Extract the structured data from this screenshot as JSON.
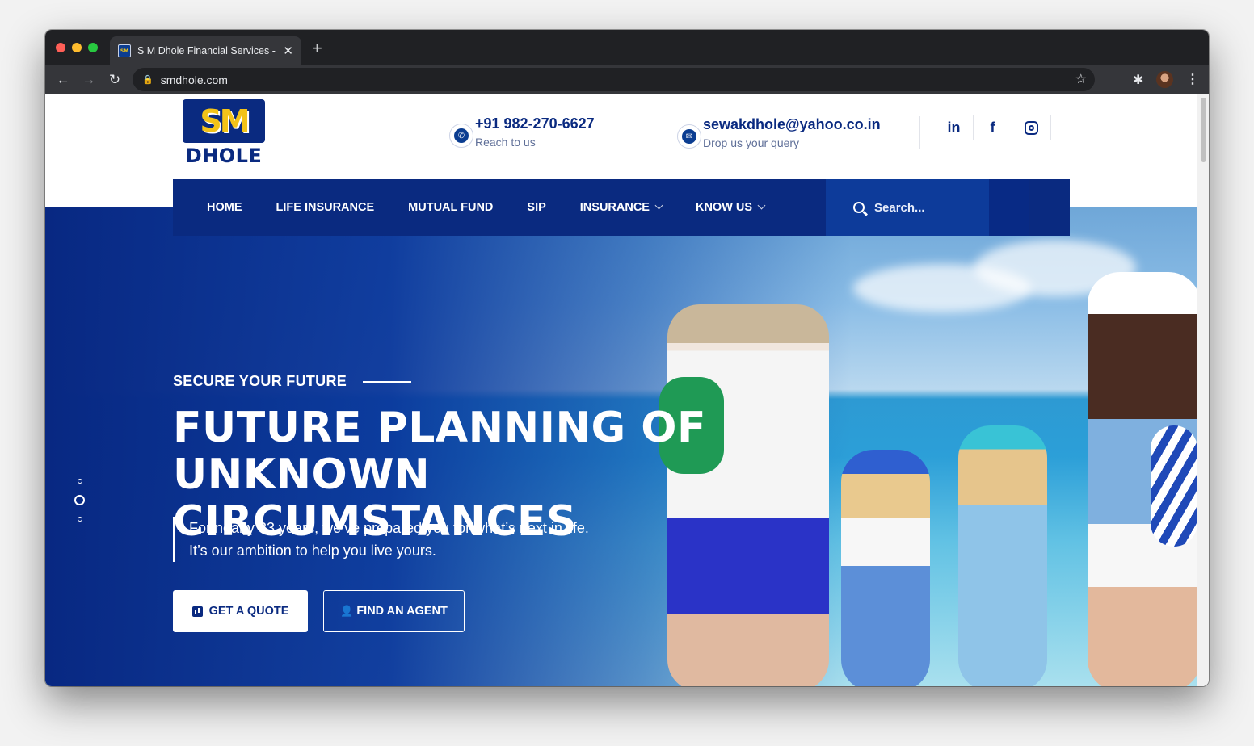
{
  "browser": {
    "tab_title": "S M Dhole Financial Services -",
    "tab_close": "✕",
    "new_tab": "+",
    "url": "smdhole.com",
    "favicon_text": "SM"
  },
  "site": {
    "logo_top": "SM",
    "logo_bottom": "DHOLE",
    "phone": "+91 982-270-6627",
    "phone_sub": "Reach to us",
    "email": "sewakdhole@yahoo.co.in",
    "email_sub": "Drop us your query",
    "social": {
      "linkedin": "in",
      "facebook": "f"
    }
  },
  "nav": {
    "items": [
      "HOME",
      "LIFE INSURANCE",
      "MUTUAL FUND",
      "SIP",
      "INSURANCE",
      "KNOW US"
    ],
    "search_placeholder": "Search..."
  },
  "hero": {
    "kicker": "SECURE YOUR FUTURE",
    "headline_1": "FUTURE PLANNING OF",
    "headline_2": "UNKNOWN CIRCUMSTANCES",
    "intro": "For nearly 33 years, we’ve prepared you for what’s next in life. It’s our ambition to help you live yours.",
    "btn_quote": "GET A QUOTE",
    "btn_agent": "FIND AN AGENT"
  },
  "colors": {
    "brand_navy": "#0a2a80",
    "search_blue": "#0d3b9a",
    "logo_yellow": "#f3c318"
  },
  "icons": [
    "back-icon",
    "forward-icon",
    "reload-icon",
    "lock-icon",
    "star-icon",
    "extensions-icon",
    "menu-icon",
    "phone-icon",
    "envelope-icon",
    "linkedin-icon",
    "facebook-icon",
    "instagram-icon",
    "search-icon",
    "chart-icon",
    "user-icon"
  ]
}
